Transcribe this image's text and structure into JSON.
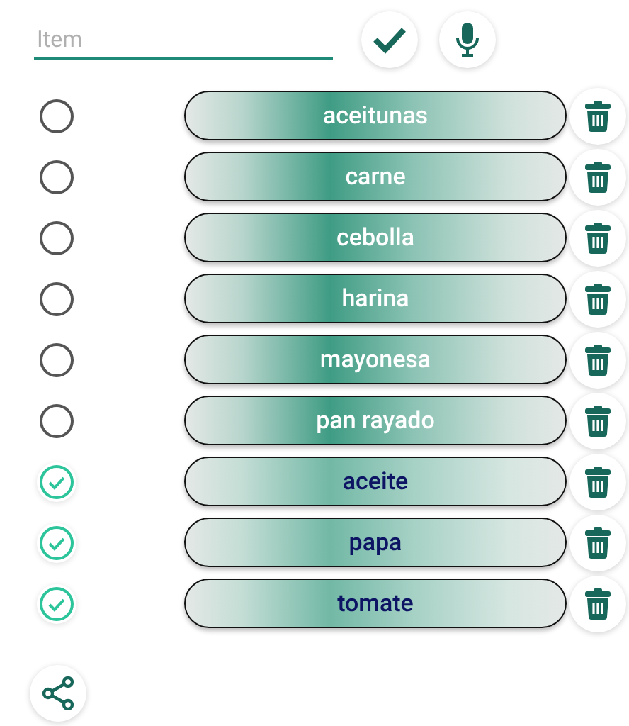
{
  "input": {
    "placeholder": "Item"
  },
  "items": [
    {
      "name": "aceitunas",
      "checked": false
    },
    {
      "name": "carne",
      "checked": false
    },
    {
      "name": "cebolla",
      "checked": false
    },
    {
      "name": "harina",
      "checked": false
    },
    {
      "name": "mayonesa",
      "checked": false
    },
    {
      "name": "pan rayado",
      "checked": false
    },
    {
      "name": "aceite",
      "checked": true
    },
    {
      "name": "papa",
      "checked": true
    },
    {
      "name": "tomate",
      "checked": true
    }
  ]
}
